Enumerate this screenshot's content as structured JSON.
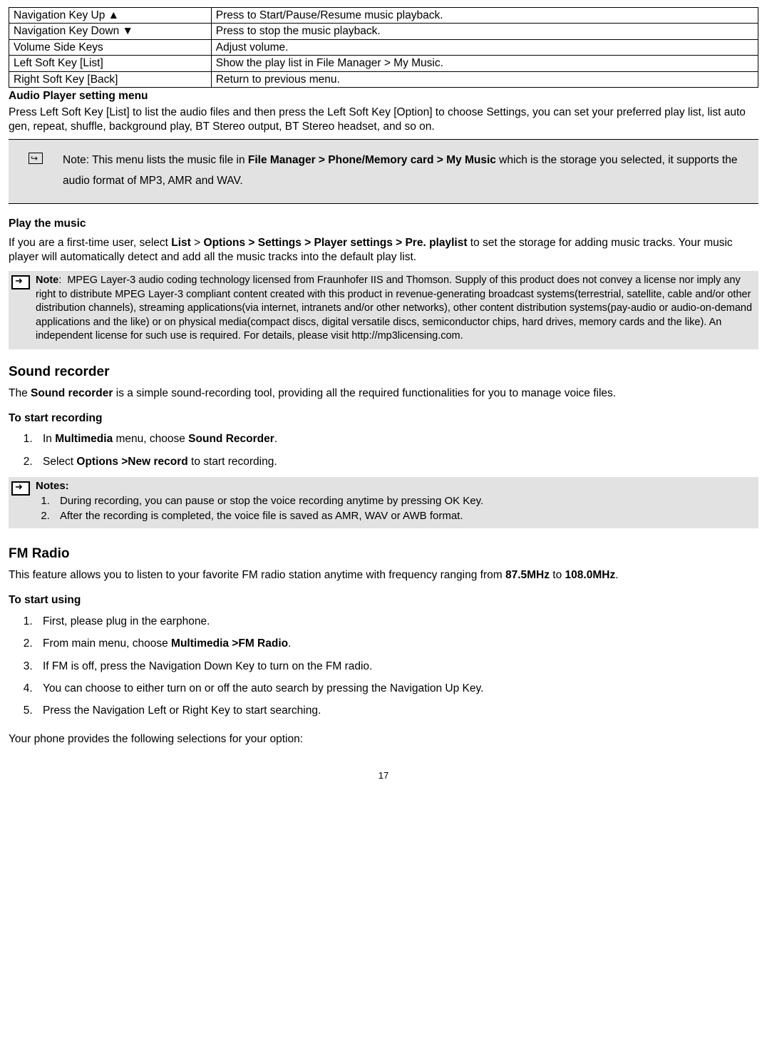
{
  "table": {
    "rows": [
      {
        "k": "Navigation Key Up ▲",
        "v": "Press to Start/Pause/Resume music playback."
      },
      {
        "k": "Navigation Key Down ▼",
        "v": "Press to stop the music playback."
      },
      {
        "k": "Volume Side Keys",
        "v": "Adjust volume."
      },
      {
        "k": "Left Soft Key [List]",
        "v": "Show the play list in File Manager > My Music."
      },
      {
        "k": "Right Soft Key [Back]",
        "v": "Return to previous menu."
      }
    ]
  },
  "audio_menu": {
    "heading": "Audio Player setting menu",
    "text": "Press Left Soft Key [List] to list the audio files and then press the Left Soft Key [Option] to choose Settings, you can set your preferred play list, list auto gen, repeat, shuffle, background play, BT Stereo output, BT Stereo headset, and so on."
  },
  "note1": {
    "pre": "Note: This menu lists the music file in ",
    "bold": "File Manager > Phone/Memory card > My Music",
    "post": " which is the storage you selected, it supports the audio format of MP3, AMR and WAV."
  },
  "play": {
    "heading": "Play the music",
    "p_pre": "If you are a first-time user, select ",
    "b1": "List",
    "mid1": " > ",
    "b2": "Options > Settings > Player settings > Pre. playlist",
    "p_post": " to set the storage for adding music tracks. Your music player will automatically detect and add all the music tracks into the default play list."
  },
  "mpeg_note": {
    "label": "Note",
    "colon": ":",
    "text": "MPEG Layer-3 audio coding technology licensed from Fraunhofer IIS and Thomson. Supply of this product does not convey a license nor imply any right to distribute MPEG Layer-3 compliant content created with this product in revenue-generating broadcast systems(terrestrial, satellite, cable and/or other distribution channels), streaming applications(via internet, intranets and/or other networks), other content distribution systems(pay-audio or audio-on-demand applications and the like) or on physical media(compact discs, digital versatile discs, semiconductor chips, hard drives, memory cards and the like). An independent license for such use is required. For details, please visit http://mp3licensing.com."
  },
  "recorder": {
    "heading": "Sound recorder",
    "p_pre": "The ",
    "b": "Sound recorder",
    "p_post": " is a simple sound-recording tool, providing all the required functionalities for you to manage voice files.",
    "sub": "To start recording",
    "step1_pre": "In ",
    "step1_b1": "Multimedia",
    "step1_mid": " menu, choose ",
    "step1_b2": "Sound Recorder",
    "step1_post": ".",
    "step2_pre": "Select ",
    "step2_b": "Options >New record",
    "step2_post": " to start recording."
  },
  "rec_notes": {
    "heading": "Notes:",
    "n1": "During recording, you can pause or stop the voice recording anytime by pressing OK Key.",
    "n2": "After the recording is completed, the voice file is saved as AMR, WAV or AWB format."
  },
  "fm": {
    "heading": "FM Radio",
    "p_pre": "This feature allows you to listen to your favorite FM radio station anytime with frequency ranging from ",
    "b1": "87.5MHz",
    "mid": " to ",
    "b2": "108.0MHz",
    "post": ".",
    "sub": "To start using",
    "s1": "First, please plug in the earphone.",
    "s2_pre": "From main menu, choose ",
    "s2_b": "Multimedia >FM Radio",
    "s2_post": ".",
    "s3": "If FM is off, press the Navigation Down Key to turn on the FM radio.",
    "s4": "You can choose to either turn on or off the auto search by pressing the Navigation Up Key.",
    "s5": "Press the Navigation Left or Right Key to start searching.",
    "closing": "Your phone provides the following selections for your option:"
  },
  "page": "17"
}
